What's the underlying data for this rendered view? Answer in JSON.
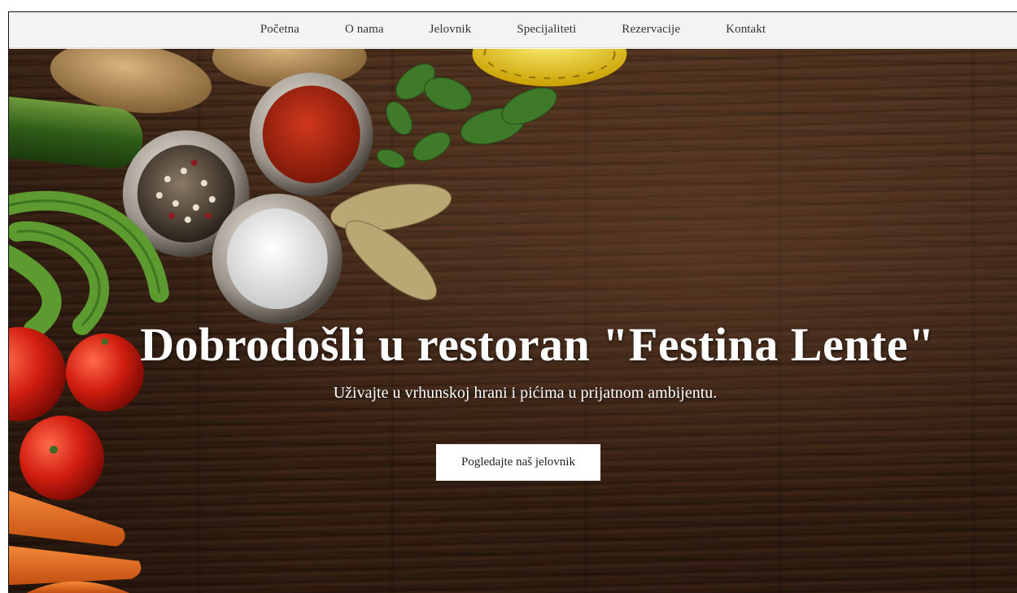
{
  "nav": {
    "items": [
      {
        "label": "Početna"
      },
      {
        "label": "O nama"
      },
      {
        "label": "Jelovnik"
      },
      {
        "label": "Specijaliteti"
      },
      {
        "label": "Rezervacije"
      },
      {
        "label": "Kontakt"
      }
    ]
  },
  "hero": {
    "title": "Dobrodošli u restoran \"Festina Lente\"",
    "subtitle": "Uživajte u vrhunskoj hrani i pićima u prijatnom ambijentu.",
    "cta_label": "Pogledajte naš jelovnik",
    "background": "wooden-table-with-vegetables-and-spices-photo"
  },
  "colors": {
    "nav_bg": "#f3f3f3",
    "nav_text": "#333333",
    "hero_text": "#ffffff",
    "button_bg": "#ffffff",
    "wood": "#3c2416"
  }
}
